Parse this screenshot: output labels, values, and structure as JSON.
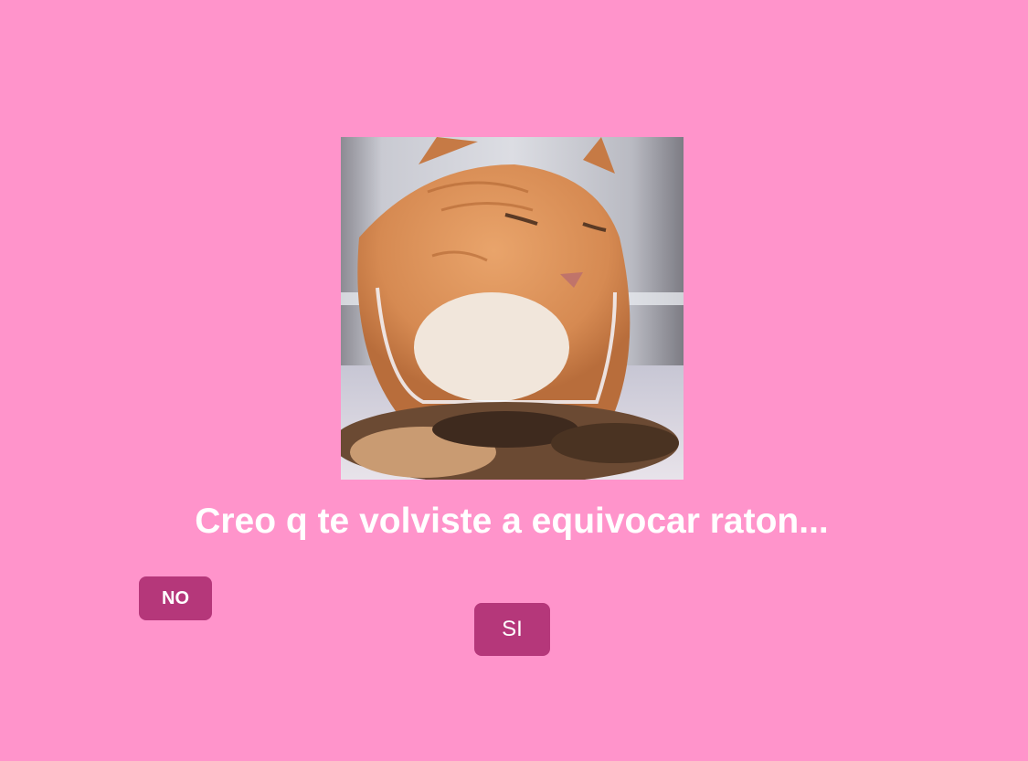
{
  "page": {
    "background_color": "#ff94cb",
    "accent_color": "#b5377a"
  },
  "image": {
    "alt": "gato naranja comiendo croquetas",
    "icon": "cat-photo"
  },
  "question": {
    "text": "Creo q te volviste a equivocar raton..."
  },
  "buttons": {
    "no_label": "NO",
    "yes_label": "SI"
  }
}
